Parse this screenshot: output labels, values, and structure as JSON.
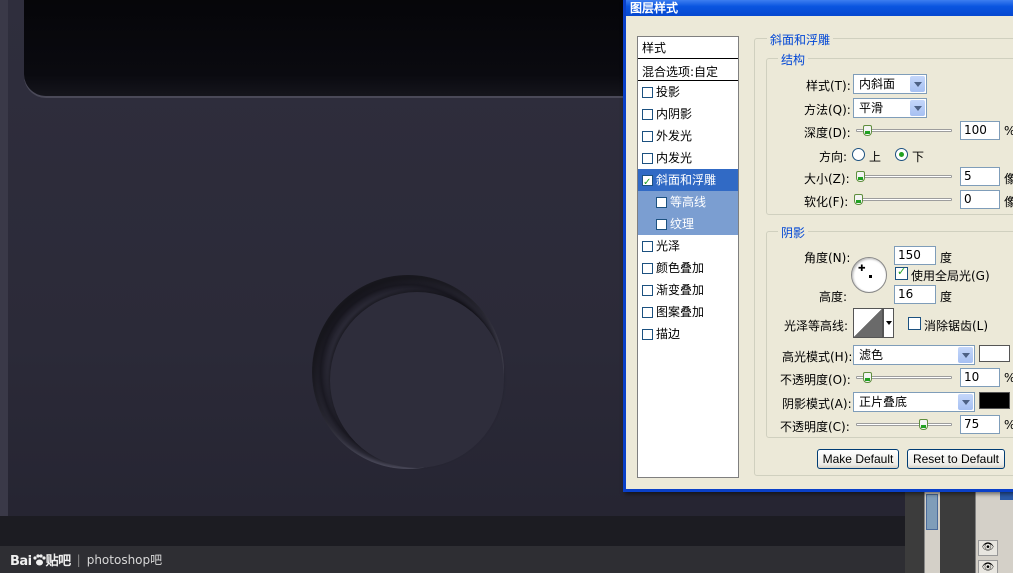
{
  "dialog": {
    "title": "图层样式"
  },
  "style_list": {
    "header": "样式",
    "blend_options": "混合选项:自定",
    "items": [
      {
        "label": "投影",
        "checked": false,
        "state": "normal"
      },
      {
        "label": "内阴影",
        "checked": false,
        "state": "normal"
      },
      {
        "label": "外发光",
        "checked": false,
        "state": "normal"
      },
      {
        "label": "内发光",
        "checked": false,
        "state": "normal"
      },
      {
        "label": "斜面和浮雕",
        "checked": true,
        "state": "selected"
      },
      {
        "label": "等高线",
        "checked": false,
        "state": "sub"
      },
      {
        "label": "纹理",
        "checked": false,
        "state": "sub"
      },
      {
        "label": "光泽",
        "checked": false,
        "state": "normal"
      },
      {
        "label": "颜色叠加",
        "checked": false,
        "state": "normal"
      },
      {
        "label": "渐变叠加",
        "checked": false,
        "state": "normal"
      },
      {
        "label": "图案叠加",
        "checked": false,
        "state": "normal"
      },
      {
        "label": "描边",
        "checked": false,
        "state": "normal"
      }
    ]
  },
  "bevel": {
    "section_title": "斜面和浮雕",
    "structure": {
      "title": "结构",
      "style_label": "样式(T):",
      "style_value": "内斜面",
      "technique_label": "方法(Q):",
      "technique_value": "平滑",
      "depth_label": "深度(D):",
      "depth_value": "100",
      "depth_unit": "%",
      "depth_level": 0.1,
      "direction_label": "方向:",
      "direction_up": "上",
      "direction_down": "下",
      "direction_selected": "下",
      "size_label": "大小(Z):",
      "size_value": "5",
      "size_unit": "像",
      "size_level": 0.02,
      "soften_label": "软化(F):",
      "soften_value": "0",
      "soften_unit": "像",
      "soften_level": 0.0
    },
    "shading": {
      "title": "阴影",
      "angle_label": "角度(N):",
      "angle_value": "150",
      "angle_unit": "度",
      "global_light_label": "使用全局光(G)",
      "global_light_checked": true,
      "altitude_label": "高度:",
      "altitude_value": "16",
      "altitude_unit": "度",
      "gloss_contour_label": "光泽等高线:",
      "anti_alias_label": "消除锯齿(L)",
      "anti_alias_checked": false,
      "highlight_mode_label": "高光模式(H):",
      "highlight_mode_value": "滤色",
      "highlight_color": "#ffffff",
      "highlight_opacity_label": "不透明度(O):",
      "highlight_opacity_value": "10",
      "highlight_opacity_unit": "%",
      "highlight_opacity_level": 0.1,
      "shadow_mode_label": "阴影模式(A):",
      "shadow_mode_value": "正片叠底",
      "shadow_color": "#000000",
      "shadow_opacity_label": "不透明度(C):",
      "shadow_opacity_value": "75",
      "shadow_opacity_unit": "%",
      "shadow_opacity_level": 0.75
    },
    "make_default": "Make Default",
    "reset_default": "Reset to Default"
  },
  "watermark": {
    "logo": "Bai",
    "logo_suffix": "贴吧",
    "separator": "|",
    "text": "photoshop吧"
  }
}
